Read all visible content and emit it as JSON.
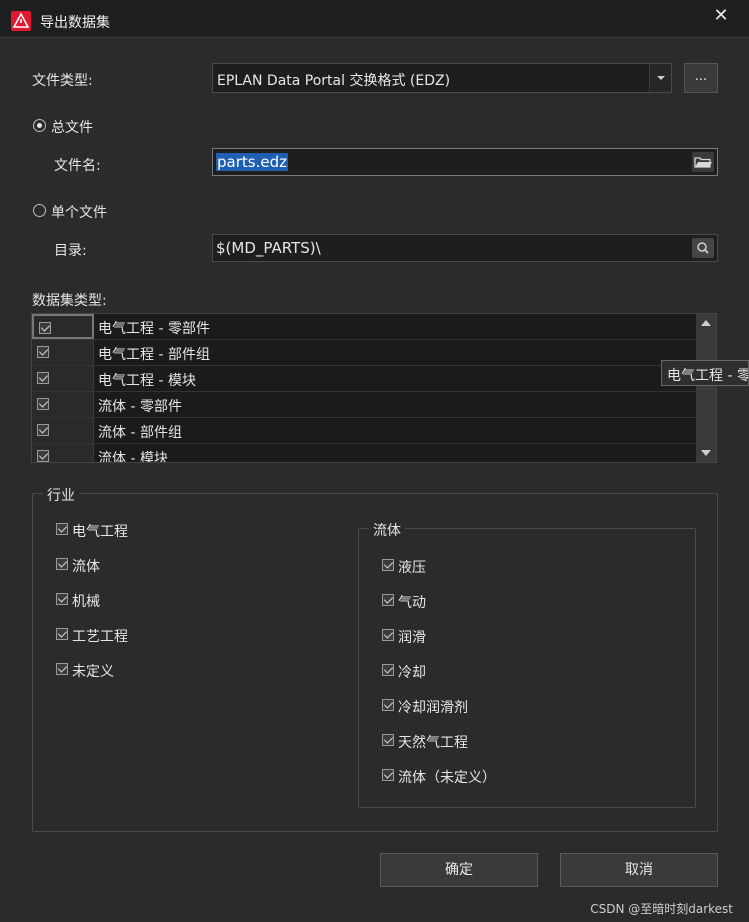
{
  "window": {
    "title": "导出数据集",
    "close_glyph": "✕",
    "icon": "eplan-logo-icon",
    "icon_color": "#e1192f"
  },
  "file_type": {
    "label": "文件类型:",
    "value": "EPLAN Data Portal 交换格式 (EDZ)",
    "browse_label": "..."
  },
  "total_file": {
    "radio_label": "总文件",
    "checked": true,
    "filename_label": "文件名:",
    "filename_value": "parts.edz",
    "icon": "folder-open-icon"
  },
  "single_file": {
    "radio_label": "单个文件",
    "checked": false,
    "dir_label": "目录:",
    "dir_value": "$(MD_PARTS)\\",
    "icon": "search-icon"
  },
  "dataset_types": {
    "label": "数据集类型:",
    "rows": [
      {
        "label": "电气工程 - 零部件",
        "checked": true
      },
      {
        "label": "电气工程 - 部件组",
        "checked": true
      },
      {
        "label": "电气工程 - 模块",
        "checked": true
      },
      {
        "label": "流体 - 零部件",
        "checked": true
      },
      {
        "label": "流体 - 部件组",
        "checked": true
      },
      {
        "label": "流体 - 模块",
        "checked": true
      }
    ],
    "tooltip": "电气工程 - 零"
  },
  "industry": {
    "title": "行业",
    "items": [
      {
        "label": "电气工程",
        "checked": true
      },
      {
        "label": "流体",
        "checked": true
      },
      {
        "label": "机械",
        "checked": true
      },
      {
        "label": "工艺工程",
        "checked": true
      },
      {
        "label": "未定义",
        "checked": true
      }
    ],
    "fluid": {
      "title": "流体",
      "items": [
        {
          "label": "液压",
          "checked": true
        },
        {
          "label": "气动",
          "checked": true
        },
        {
          "label": "润滑",
          "checked": true
        },
        {
          "label": "冷却",
          "checked": true
        },
        {
          "label": "冷却润滑剂",
          "checked": true
        },
        {
          "label": "天然气工程",
          "checked": true
        },
        {
          "label": "流体（未定义）",
          "checked": true
        }
      ]
    }
  },
  "buttons": {
    "ok": "确定",
    "cancel": "取消"
  },
  "watermark": "CSDN @至暗时刻darkest",
  "colors": {
    "background": "#2b2b2b",
    "titlebar": "#1f1f1f",
    "selection": "#1f5fb3"
  }
}
